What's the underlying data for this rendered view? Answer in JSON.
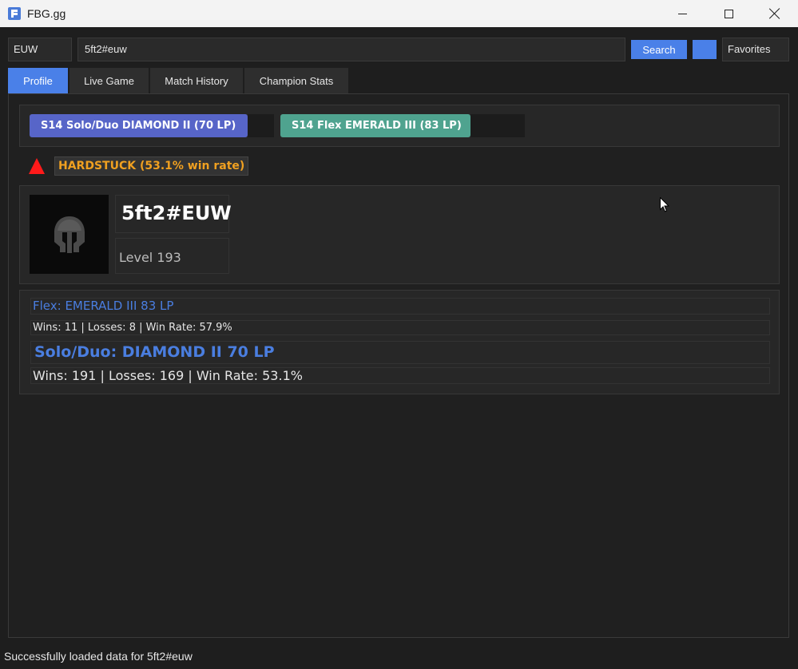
{
  "window": {
    "title": "FBG.gg",
    "controls": {
      "minimize": "minimize-icon",
      "maximize": "maximize-icon",
      "close": "close-icon"
    }
  },
  "search": {
    "region": "EUW",
    "query": "5ft2#euw",
    "search_label": "Search",
    "favorites_label": "Favorites"
  },
  "tabs": [
    {
      "label": "Profile",
      "active": true
    },
    {
      "label": "Live Game",
      "active": false
    },
    {
      "label": "Match History",
      "active": false
    },
    {
      "label": "Champion Stats",
      "active": false
    }
  ],
  "ranks": {
    "solo_label": "S14 Solo/Duo DIAMOND II (70 LP)",
    "flex_label": "S14 Flex EMERALD III (83 LP)",
    "solo_color": "#5765c8",
    "flex_color": "#4fa38f"
  },
  "warning": {
    "icon": "warning-triangle-icon",
    "text": "HARDSTUCK (53.1% win rate)",
    "color": "#f0a020"
  },
  "profile": {
    "name": "5ft2#EUW",
    "level": "Level 193",
    "avatar_icon": "helmet-icon"
  },
  "stats": {
    "flex_title": "Flex: EMERALD III 83 LP",
    "flex_stats": "Wins: 11 | Losses: 8 | Win Rate: 57.9%",
    "solo_title": "Solo/Duo: DIAMOND II 70 LP",
    "solo_stats": "Wins: 191 | Losses: 169 | Win Rate: 53.1%"
  },
  "status": "Successfully loaded data for 5ft2#euw",
  "colors": {
    "accent": "#4a80e8",
    "background": "#1e1e1e"
  }
}
